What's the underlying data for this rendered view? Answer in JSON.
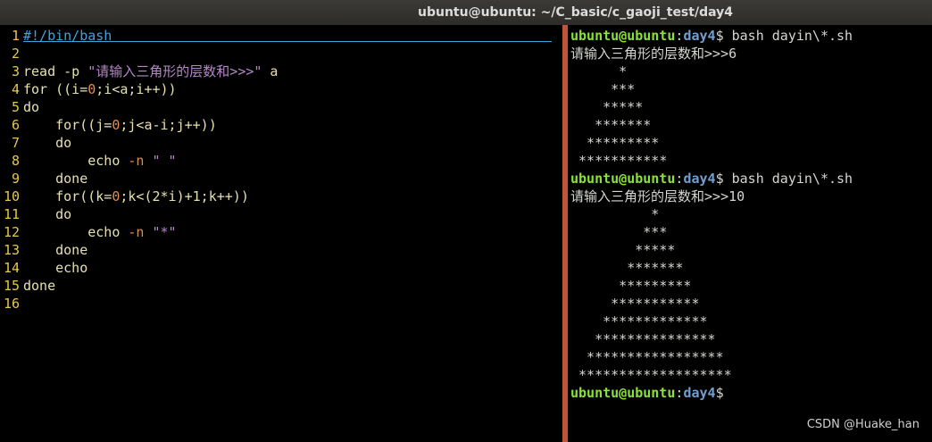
{
  "window": {
    "title": "ubuntu@ubuntu: ~/C_basic/c_gaoji_test/day4"
  },
  "editor": {
    "lines": [
      {
        "n": "1",
        "parts": [
          {
            "t": "#!/bin/bash",
            "c": "cm"
          }
        ]
      },
      {
        "n": "2",
        "parts": []
      },
      {
        "n": "3",
        "parts": [
          {
            "t": "read -p ",
            "c": "code"
          },
          {
            "t": "\"请输入三角形的层数和>>>\"",
            "c": "str"
          },
          {
            "t": " a",
            "c": "code"
          }
        ]
      },
      {
        "n": "4",
        "parts": [
          {
            "t": "for ((i=",
            "c": "code"
          },
          {
            "t": "0",
            "c": "num"
          },
          {
            "t": ";i<a;i++))",
            "c": "code"
          }
        ]
      },
      {
        "n": "5",
        "parts": [
          {
            "t": "do",
            "c": "code"
          }
        ]
      },
      {
        "n": "6",
        "parts": [
          {
            "t": "    for((j=",
            "c": "code"
          },
          {
            "t": "0",
            "c": "num"
          },
          {
            "t": ";j<a-i;j++))",
            "c": "code"
          }
        ]
      },
      {
        "n": "7",
        "parts": [
          {
            "t": "    do",
            "c": "code"
          }
        ]
      },
      {
        "n": "8",
        "parts": [
          {
            "t": "        echo ",
            "c": "code"
          },
          {
            "t": "-n",
            "c": "flag"
          },
          {
            "t": " \" \"",
            "c": "str"
          }
        ]
      },
      {
        "n": "9",
        "parts": [
          {
            "t": "    done",
            "c": "code"
          }
        ]
      },
      {
        "n": "10",
        "parts": [
          {
            "t": "    for((k=",
            "c": "code"
          },
          {
            "t": "0",
            "c": "num"
          },
          {
            "t": ";k<(2*i)+1;k++))",
            "c": "code"
          }
        ]
      },
      {
        "n": "11",
        "parts": [
          {
            "t": "    do",
            "c": "code"
          }
        ]
      },
      {
        "n": "12",
        "parts": [
          {
            "t": "        echo ",
            "c": "code"
          },
          {
            "t": "-n",
            "c": "flag"
          },
          {
            "t": " \"*\"",
            "c": "str"
          }
        ]
      },
      {
        "n": "13",
        "parts": [
          {
            "t": "    done",
            "c": "code"
          }
        ]
      },
      {
        "n": "14",
        "parts": [
          {
            "t": "    echo",
            "c": "code"
          }
        ]
      },
      {
        "n": "15",
        "parts": [
          {
            "t": "done",
            "c": "code"
          }
        ]
      },
      {
        "n": "16",
        "parts": []
      }
    ]
  },
  "terminal": {
    "lines": [
      {
        "prompt": true,
        "user": "ubuntu@ubuntu",
        "path": "day4",
        "cmd": " bash dayin\\*.sh"
      },
      {
        "text": "请输入三角形的层数和>>>6"
      },
      {
        "text": "      *"
      },
      {
        "text": "     ***"
      },
      {
        "text": "    *****"
      },
      {
        "text": "   *******"
      },
      {
        "text": "  *********"
      },
      {
        "text": " ***********"
      },
      {
        "prompt": true,
        "user": "ubuntu@ubuntu",
        "path": "day4",
        "cmd": " bash dayin\\*.sh"
      },
      {
        "text": "请输入三角形的层数和>>>10"
      },
      {
        "text": "          *"
      },
      {
        "text": "         ***"
      },
      {
        "text": "        *****"
      },
      {
        "text": "       *******"
      },
      {
        "text": "      *********"
      },
      {
        "text": "     ***********"
      },
      {
        "text": "    *************"
      },
      {
        "text": "   ***************"
      },
      {
        "text": "  *****************"
      },
      {
        "text": " *******************"
      },
      {
        "prompt": true,
        "user": "ubuntu@ubuntu",
        "path": "day4",
        "cmd": ""
      }
    ]
  },
  "watermark": "CSDN @Huake_han"
}
